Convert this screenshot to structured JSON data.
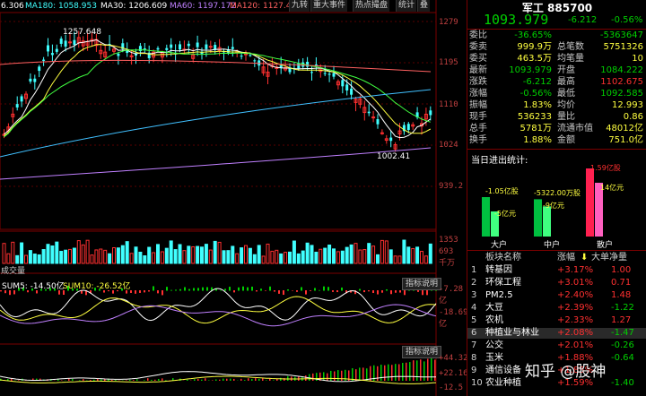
{
  "header": {
    "sector_name": "军工",
    "sector_code": "885700",
    "price": "1093.979",
    "change": "-6.212",
    "change_pct": "-0.56%"
  },
  "chart": {
    "ma_labels": [
      {
        "text": "6.306",
        "color": "#ffffff"
      },
      {
        "text": "MA180: 1058.953",
        "color": "#40ffff"
      },
      {
        "text": "MA30: 1206.609",
        "color": "#ffffff"
      },
      {
        "text": "MA60: 1197.172",
        "color": "#c080ff"
      },
      {
        "text": "MA120: 1127.475",
        "color": "#ff6060"
      }
    ],
    "toolbar": [
      "九转",
      "重大事件",
      "热点撮盘",
      "统计",
      "叠"
    ],
    "price_axis": [
      "1279",
      "1195",
      "1110",
      "1024",
      "939.2"
    ],
    "high_marker": "1257.648",
    "low_marker": "1002.41",
    "volume_axis": [
      "1353",
      "693",
      "千万"
    ],
    "volume_label": "成交量",
    "indicator1": {
      "labels": [
        "SUM5: -14.50亿",
        "SUM10: -26.52亿"
      ],
      "button": "指标说明",
      "axis": [
        "-7.28亿",
        "-18.69亿"
      ]
    },
    "indicator2": {
      "button": "指标说明",
      "axis": [
        "+44.32",
        "+22.16",
        "-12.5"
      ]
    }
  },
  "quote": {
    "rows": [
      {
        "k1": "委比",
        "v1": "-36.65%",
        "c1": "green",
        "k2": "",
        "v2": "-5363647",
        "c2": "green"
      },
      {
        "k1": "委卖",
        "v1": "999.9万",
        "c1": "yellow",
        "k2": "总笔数",
        "v2": "5751326",
        "c2": "yellow"
      },
      {
        "k1": "委买",
        "v1": "463.5万",
        "c1": "yellow",
        "k2": "均笔量",
        "v2": "10",
        "c2": "yellow"
      },
      {
        "k1": "最新",
        "v1": "1093.979",
        "c1": "green",
        "k2": "开盘",
        "v2": "1084.222",
        "c2": "green"
      },
      {
        "k1": "涨跌",
        "v1": "-6.212",
        "c1": "green",
        "k2": "最高",
        "v2": "1102.675",
        "c2": "red"
      },
      {
        "k1": "涨幅",
        "v1": "-0.56%",
        "c1": "green",
        "k2": "最低",
        "v2": "1092.585",
        "c2": "green"
      },
      {
        "k1": "振幅",
        "v1": "1.83%",
        "c1": "yellow",
        "k2": "均价",
        "v2": "12.993",
        "c2": "yellow"
      },
      {
        "k1": "现手",
        "v1": "536233",
        "c1": "yellow",
        "k2": "量比",
        "v2": "0.86",
        "c2": "yellow"
      },
      {
        "k1": "总手",
        "v1": "5781万",
        "c1": "yellow",
        "k2": "流通市值",
        "v2": "48012亿",
        "c2": "yellow"
      },
      {
        "k1": "换手",
        "v1": "1.88%",
        "c1": "yellow",
        "k2": "金额",
        "v2": "751.0亿",
        "c2": "yellow"
      }
    ]
  },
  "flow": {
    "title": "当日进出统计:",
    "labels": {
      "big": "大户",
      "mid": "中户",
      "small": "散户"
    },
    "big_top": "-1.05亿股",
    "big_bot": "-5亿元",
    "mid_top": "-5322.00万股",
    "mid_bot": "-9亿元",
    "small_top": "1.59亿股",
    "small_bot": "14亿元",
    "values": {
      "big_in": 0.55,
      "big_out": 0.35,
      "mid_in": 0.52,
      "mid_out": 0.42,
      "small_in": 0.95,
      "small_out": 0.75
    }
  },
  "list": {
    "headers": [
      "板块名称",
      "涨幅",
      "大单净量"
    ],
    "rows": [
      {
        "idx": "1",
        "name": "转基因",
        "pct": "+3.17%",
        "net": "1.00",
        "net_color": "red"
      },
      {
        "idx": "2",
        "name": "环保工程",
        "pct": "+3.01%",
        "net": "0.71",
        "net_color": "red"
      },
      {
        "idx": "3",
        "name": "PM2.5",
        "pct": "+2.40%",
        "net": "1.48",
        "net_color": "red"
      },
      {
        "idx": "4",
        "name": "大豆",
        "pct": "+2.39%",
        "net": "-1.22",
        "net_color": "green"
      },
      {
        "idx": "5",
        "name": "农机",
        "pct": "+2.33%",
        "net": "1.27",
        "net_color": "red"
      },
      {
        "idx": "6",
        "name": "种植业与林业",
        "pct": "+2.08%",
        "net": "-1.47",
        "net_color": "green"
      },
      {
        "idx": "7",
        "name": "公交",
        "pct": "+2.01%",
        "net": "-0.26",
        "net_color": "green"
      },
      {
        "idx": "8",
        "name": "玉米",
        "pct": "+1.88%",
        "net": "-0.64",
        "net_color": "green"
      },
      {
        "idx": "9",
        "name": "通信设备",
        "pct": "+1.85%",
        "net": "",
        "net_color": "red"
      },
      {
        "idx": "10",
        "name": "农业种植",
        "pct": "+1.59%",
        "net": "-1.40",
        "net_color": "green"
      }
    ]
  },
  "watermark": "知乎 @股神"
}
